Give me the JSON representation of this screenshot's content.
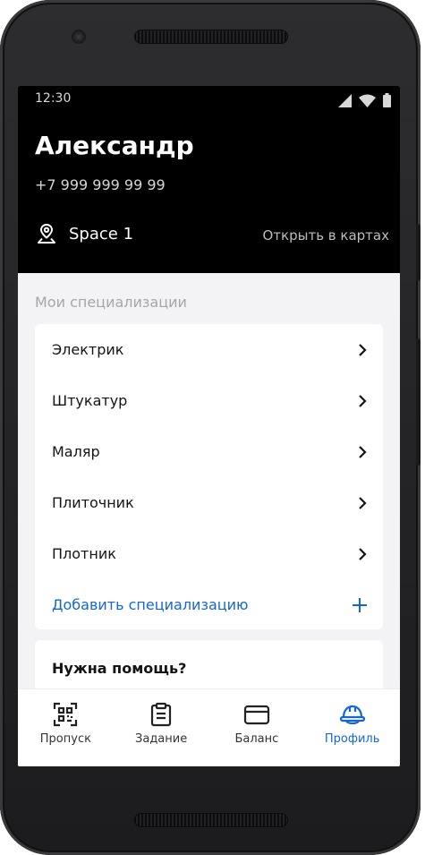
{
  "status_bar": {
    "time": "12:30"
  },
  "profile": {
    "name": "Александр",
    "phone": "+7 999 999 99 99",
    "location": "Space 1",
    "open_map_label": "Открыть в картах"
  },
  "specializations": {
    "title": "Мои специализации",
    "items": [
      "Электрик",
      "Штукатур",
      "Маляр",
      "Плиточник",
      "Плотник"
    ],
    "add_label": "Добавить специализацию"
  },
  "help": {
    "title": "Нужна помощь?"
  },
  "tabs": [
    {
      "label": "Пропуск",
      "icon": "qr-code-icon",
      "active": false
    },
    {
      "label": "Задание",
      "icon": "clipboard-icon",
      "active": false
    },
    {
      "label": "Баланс",
      "icon": "card-icon",
      "active": false
    },
    {
      "label": "Профиль",
      "icon": "helmet-icon",
      "active": true
    }
  ],
  "colors": {
    "accent": "#1466d8",
    "header_bg": "#000000",
    "screen_bg": "#f3f3f5"
  }
}
